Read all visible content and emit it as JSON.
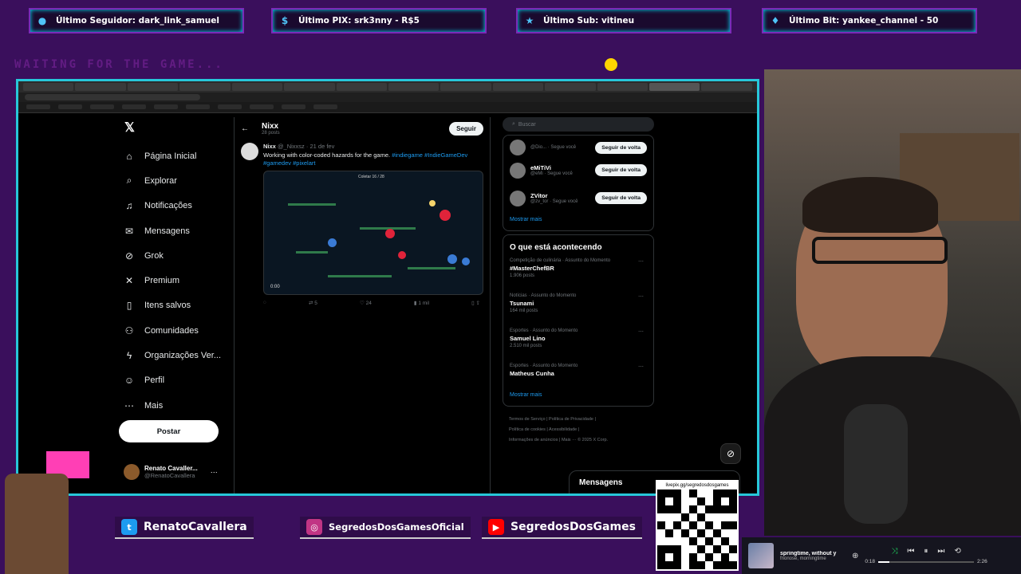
{
  "alerts": [
    {
      "icon": "user-icon",
      "text": "Último Seguidor: dark_link_samuel"
    },
    {
      "icon": "dollar-icon",
      "text": "Último PIX: srk3nny - R$5"
    },
    {
      "icon": "star-icon",
      "text": "Último Sub: vitineu"
    },
    {
      "icon": "gem-icon",
      "text": "Último Bit: yankee_channel - 50"
    }
  ],
  "waiting_text": "WAITING FOR THE GAME...",
  "x": {
    "nav": [
      {
        "icon": "home-icon",
        "label": "Página Inicial"
      },
      {
        "icon": "search-icon",
        "label": "Explorar"
      },
      {
        "icon": "bell-icon",
        "label": "Notificações"
      },
      {
        "icon": "mail-icon",
        "label": "Mensagens"
      },
      {
        "icon": "grok-icon",
        "label": "Grok"
      },
      {
        "icon": "x-premium-icon",
        "label": "Premium"
      },
      {
        "icon": "bookmark-icon",
        "label": "Itens salvos"
      },
      {
        "icon": "communities-icon",
        "label": "Comunidades"
      },
      {
        "icon": "lightning-icon",
        "label": "Organizações Ver..."
      },
      {
        "icon": "person-icon",
        "label": "Perfil"
      },
      {
        "icon": "more-icon",
        "label": "Mais"
      }
    ],
    "post_label": "Postar",
    "account": {
      "name": "Renato Cavaller...",
      "handle": "@RenatoCavallera"
    },
    "profile_header": {
      "name": "Nixx",
      "count": "28 posts",
      "follow_label": "Seguir"
    },
    "tweet": {
      "author": "Nixx",
      "handle_date": "@_Nixxsz · 21 de fev",
      "text": "Working with color-coded hazards for the game.",
      "hashtags": "#indiegame #IndieGameDev #gamedev #pixelart",
      "video_time": "0:00",
      "media_caption": "Coletar 16 / 28",
      "replies": "",
      "retweets": "5",
      "likes": "24",
      "views": "1 mil"
    },
    "search_placeholder": "Buscar",
    "who_to_follow": [
      {
        "name": "",
        "handle": "@Dio... · Segue você",
        "button": "Seguir de volta"
      },
      {
        "name": "eMiTiVi",
        "handle": "@eMi · Segue você",
        "button": "Seguir de volta"
      },
      {
        "name": "ZVitor",
        "handle": "@zv_tor · Segue você",
        "button": "Seguir de volta"
      }
    ],
    "show_more": "Mostrar mais",
    "trends_title": "O que está acontecendo",
    "trends": [
      {
        "context": "Competição de culinária · Assunto do Momento",
        "name": "#MasterChefBR",
        "posts": "1.906 posts"
      },
      {
        "context": "Notícias · Assunto do Momento",
        "name": "Tsunami",
        "posts": "164 mil posts"
      },
      {
        "context": "Esportes · Assunto do Momento",
        "name": "Samuel Lino",
        "posts": "2.510 mil posts"
      },
      {
        "context": "Esportes · Assunto do Momento",
        "name": "Matheus Cunha",
        "posts": ""
      }
    ],
    "show_more_trends": "Mostrar mais",
    "footer": [
      "Termos de Serviço | Política de Privacidade |",
      "Política de cookies | Acessibilidade |",
      "Informações de anúncios | Mais ··· © 2025 X Corp."
    ],
    "messages_label": "Mensagens"
  },
  "socials": [
    {
      "icon": "twitter-icon",
      "text": "RenatoCavallera",
      "color": "#1d9bf0"
    },
    {
      "icon": "instagram-icon",
      "text": "SegredosDosGamesOficial",
      "color": "#c13584"
    },
    {
      "icon": "youtube-icon",
      "text": "SegredosDosGames",
      "color": "#ff0000"
    }
  ],
  "qr_caption": "livepix.gg/segredosdosgames",
  "music": {
    "title": "springtime, without y",
    "artist": "fnonose, morningtime",
    "elapsed": "0:18",
    "total": "2:26",
    "progress": 0.12
  }
}
